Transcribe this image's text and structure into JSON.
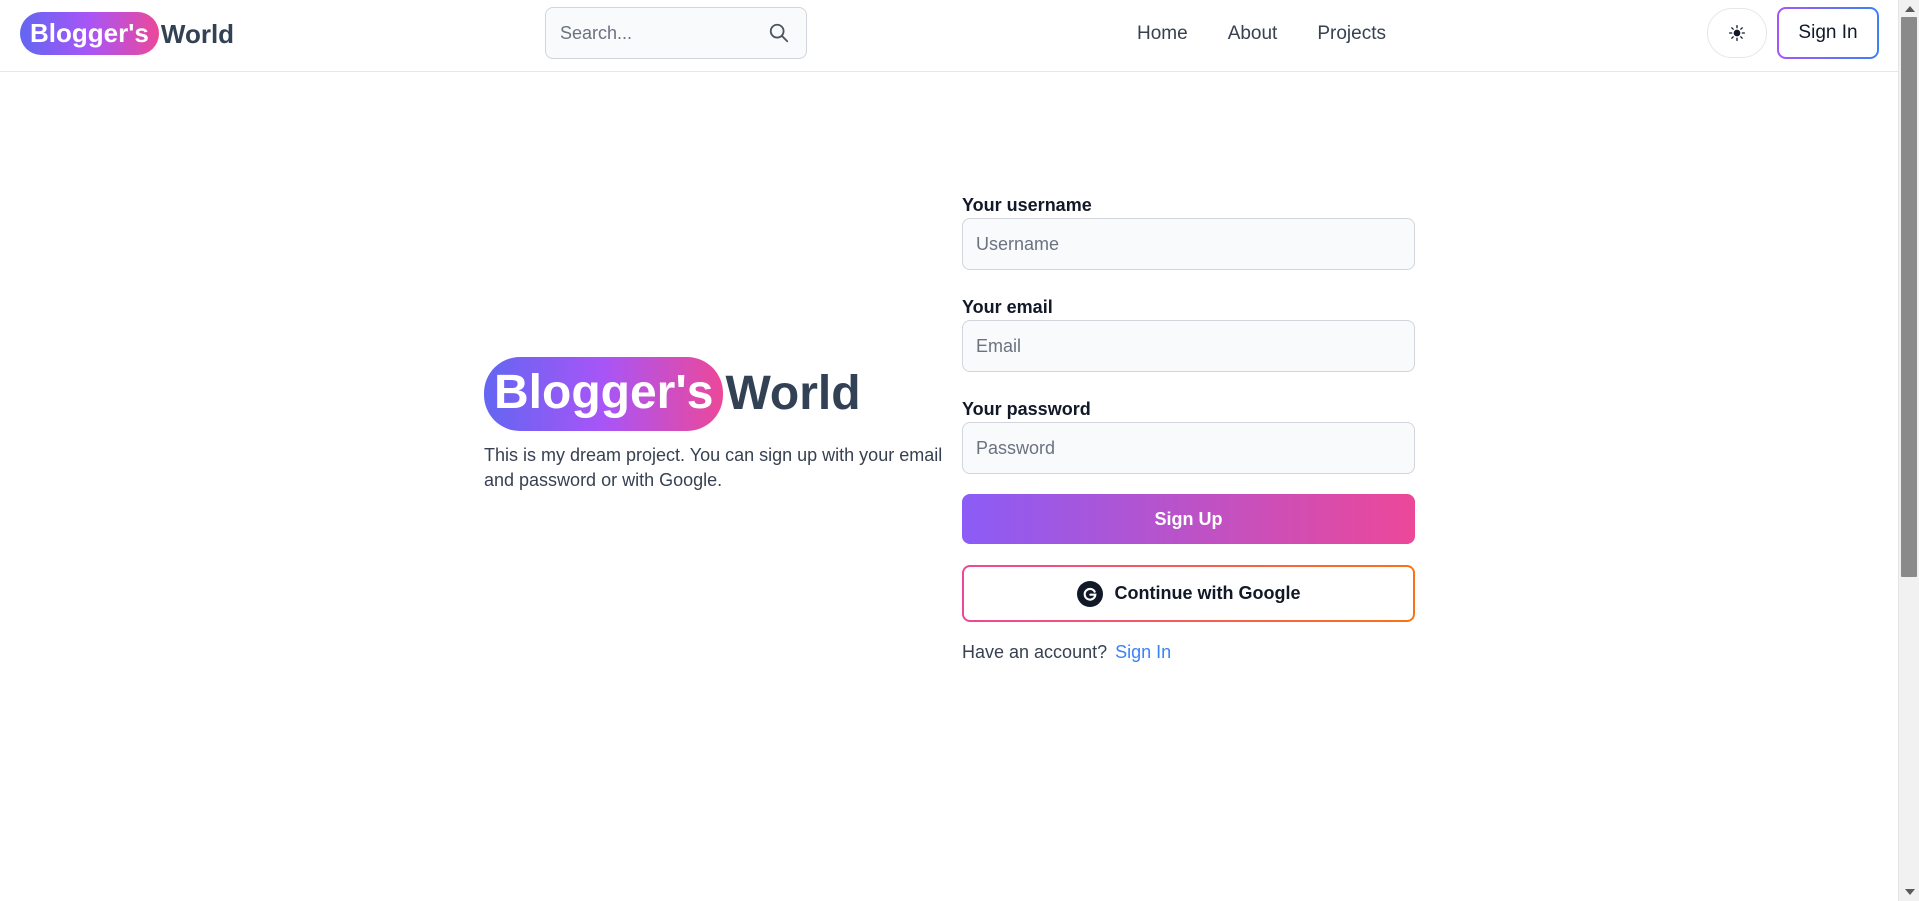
{
  "navbar": {
    "brand_pill": "Blogger's",
    "brand_rest": "World",
    "search_placeholder": "Search...",
    "links": [
      "Home",
      "About",
      "Projects"
    ],
    "theme_toggle_icon": "sun-icon",
    "signin_label": "Sign In"
  },
  "hero": {
    "brand_pill": "Blogger's",
    "brand_rest": "World",
    "description": "This is my dream project. You can sign up with your email and password or with Google."
  },
  "form": {
    "username_label": "Your username",
    "username_placeholder": "Username",
    "email_label": "Your email",
    "email_placeholder": "Email",
    "password_label": "Your password",
    "password_placeholder": "Password",
    "signup_label": "Sign Up",
    "google_label": "Continue with Google",
    "account_text": "Have an account?",
    "signin_link": "Sign In"
  },
  "colors": {
    "brand_gradient": [
      "#6366f1",
      "#a855f7",
      "#ec4899"
    ],
    "signup_gradient": [
      "#8b5cf6",
      "#ec4899"
    ],
    "google_border_gradient": [
      "#ec4899",
      "#f97316"
    ],
    "signin_border_gradient": [
      "#a855f7",
      "#3b82f6"
    ],
    "link": "#3b82f6"
  }
}
